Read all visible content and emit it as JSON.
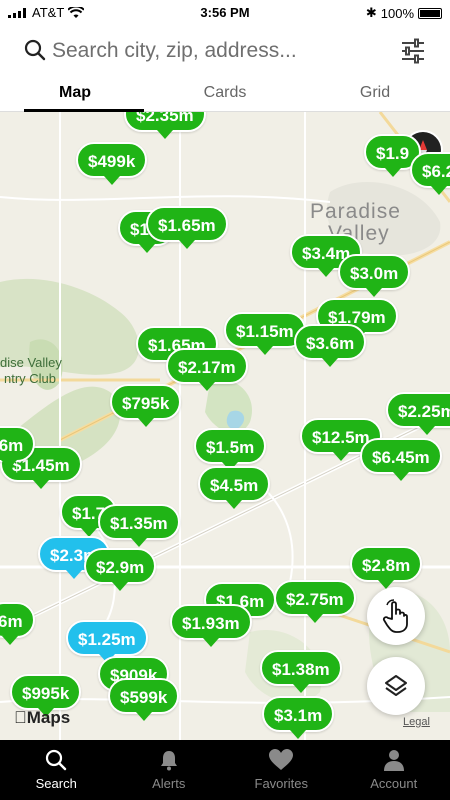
{
  "status_bar": {
    "carrier": "AT&T",
    "time": "3:56 PM",
    "battery_label": "100%"
  },
  "search": {
    "placeholder": "Search city, zip, address..."
  },
  "tabs": [
    {
      "label": "Map",
      "active": true
    },
    {
      "label": "Cards",
      "active": false
    },
    {
      "label": "Grid",
      "active": false
    }
  ],
  "map": {
    "area_label": "Paradise",
    "area_label2": "Valley",
    "club_label": "dise Valley",
    "club_label2": "ntry Club",
    "maps_logo": "Maps",
    "legal": "Legal",
    "pins": [
      {
        "price": "$2.35m",
        "color": "green"
      },
      {
        "price": "$499k",
        "color": "green"
      },
      {
        "price": "$1.6",
        "color": "green"
      },
      {
        "price": "$1.65m",
        "color": "green"
      },
      {
        "price": "$3.4m",
        "color": "green"
      },
      {
        "price": "$3.0m",
        "color": "green"
      },
      {
        "price": "$1.79m",
        "color": "green"
      },
      {
        "price": "$1.15m",
        "color": "green"
      },
      {
        "price": "$3.6m",
        "color": "green"
      },
      {
        "price": "$1.65m",
        "color": "green"
      },
      {
        "price": "$2.17m",
        "color": "green"
      },
      {
        "price": "$795k",
        "color": "green"
      },
      {
        "price": "$2.25m",
        "color": "green"
      },
      {
        "price": "$12.5m",
        "color": "green"
      },
      {
        "price": "$6.45m",
        "color": "green"
      },
      {
        "price": "$1.5m",
        "color": "green"
      },
      {
        "price": "$4.5m",
        "color": "green"
      },
      {
        "price": "$1.45m",
        "color": "green"
      },
      {
        "price": "$1.7",
        "color": "green"
      },
      {
        "price": "$1.35m",
        "color": "green"
      },
      {
        "price": "$2.3m",
        "color": "blue"
      },
      {
        "price": "$2.9m",
        "color": "green"
      },
      {
        "price": "$2.8m",
        "color": "green"
      },
      {
        "price": "$1.6m",
        "color": "green"
      },
      {
        "price": "$2.75m",
        "color": "green"
      },
      {
        "price": "$1.93m",
        "color": "green"
      },
      {
        "price": "$1.25m",
        "color": "blue"
      },
      {
        "price": "$909k",
        "color": "green"
      },
      {
        "price": "$995k",
        "color": "green"
      },
      {
        "price": "$599k",
        "color": "green"
      },
      {
        "price": "$1.38m",
        "color": "green"
      },
      {
        "price": "$3.1m",
        "color": "green"
      },
      {
        "price": "$1.9",
        "color": "green"
      },
      {
        "price": "$6.2",
        "color": "green"
      },
      {
        "price": "6m",
        "color": "green"
      },
      {
        "price": ".6m",
        "color": "green"
      }
    ]
  },
  "nav": [
    {
      "label": "Search",
      "icon": "search-icon",
      "active": true
    },
    {
      "label": "Alerts",
      "icon": "bell-icon",
      "active": false
    },
    {
      "label": "Favorites",
      "icon": "heart-icon",
      "active": false
    },
    {
      "label": "Account",
      "icon": "person-icon",
      "active": false
    }
  ],
  "colors": {
    "pin_green": "#20b416",
    "pin_blue": "#22c0ec",
    "nav_bg": "#000000"
  }
}
